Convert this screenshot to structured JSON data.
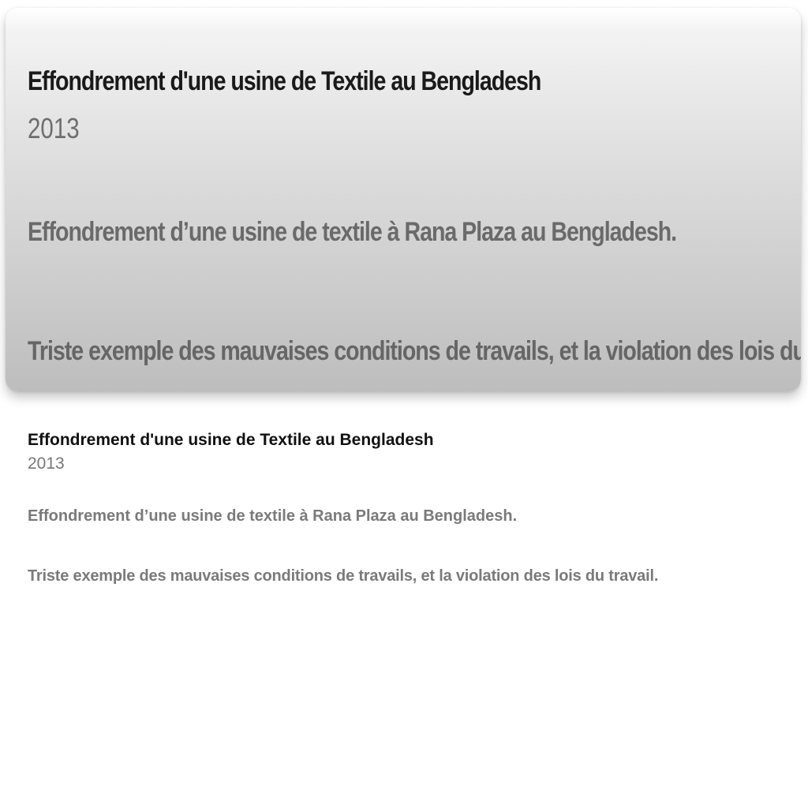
{
  "card": {
    "title": "Effondrement d'une usine de Textile au Bengladesh",
    "year": "2013",
    "line1": "Effondrement d’une usine de textile à Rana Plaza au Bengladesh.",
    "line2": "Triste exemple des mauvaises conditions de travails, et la violation des lois du travail."
  },
  "details": {
    "title": "Effondrement d'une usine de Textile au Bengladesh",
    "year": "2013",
    "line1": "Effondrement d’une usine de textile à Rana Plaza au Bengladesh.",
    "line2": "Triste exemple des mauvaises conditions de travails, et la violation des lois du travail."
  }
}
